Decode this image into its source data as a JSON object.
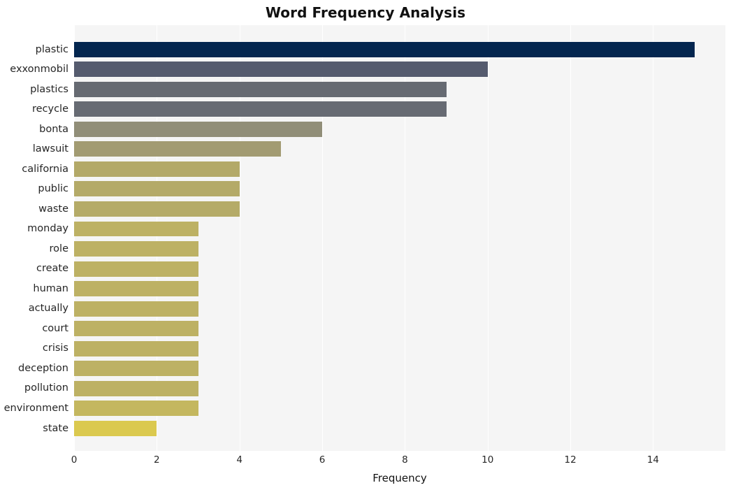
{
  "chart_data": {
    "type": "bar",
    "orientation": "horizontal",
    "title": "Word Frequency Analysis",
    "xlabel": "Frequency",
    "ylabel": "",
    "categories": [
      "plastic",
      "exxonmobil",
      "plastics",
      "recycle",
      "bonta",
      "lawsuit",
      "california",
      "public",
      "waste",
      "monday",
      "role",
      "create",
      "human",
      "actually",
      "court",
      "crisis",
      "deception",
      "pollution",
      "environment",
      "state"
    ],
    "values": [
      15,
      10,
      9,
      9,
      6,
      5,
      4,
      4,
      4,
      3,
      3,
      3,
      3,
      3,
      3,
      3,
      3,
      3,
      3,
      2
    ],
    "bar_colors": [
      "#04264f",
      "#555b6e",
      "#666a72",
      "#676b73",
      "#918e78",
      "#a29b72",
      "#b3a968",
      "#b4aa68",
      "#b5ab68",
      "#bdb164",
      "#bdb164",
      "#bdb164",
      "#bdb164",
      "#bdb164",
      "#bdb164",
      "#bdb164",
      "#bdb164",
      "#bdb164",
      "#c4b75f",
      "#dbc94f"
    ],
    "xticks": [
      0,
      2,
      4,
      6,
      8,
      10,
      12,
      14
    ],
    "xlim": [
      0,
      15.75
    ],
    "grid": true,
    "grid_axis": "x",
    "grid_color": "#ffffff",
    "plot_background": "#f5f5f5",
    "figure_background": "#ffffff",
    "legend": null
  }
}
